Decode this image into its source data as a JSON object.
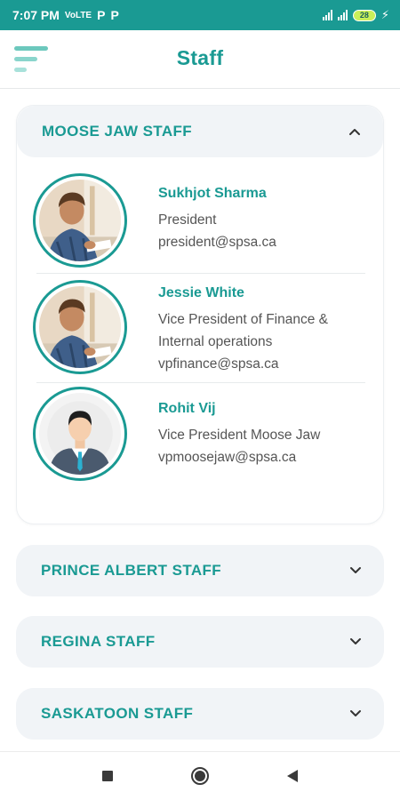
{
  "status_bar": {
    "time": "7:07 PM",
    "left_icons": [
      "volte-icon",
      "p-icon",
      "p-icon"
    ],
    "p_label": "P",
    "volte_label": "VoLTE",
    "battery": "28",
    "colors": {
      "bar": "#1a9a93",
      "battery": "#c9ef5a"
    }
  },
  "header": {
    "title": "Staff",
    "menu_icon": "menu-icon"
  },
  "sections": [
    {
      "title": "MOOSE JAW STAFF",
      "expanded": true,
      "chevron": "chevron-up-icon",
      "staff": [
        {
          "name": "Sukhjot Sharma",
          "role": "President",
          "email": "president@spsa.ca",
          "avatar": "photo"
        },
        {
          "name": "Jessie White",
          "role": "Vice President of Finance & Internal operations",
          "email": "vpfinance@spsa.ca",
          "avatar": "photo"
        },
        {
          "name": "Rohit Vij",
          "role": "Vice President Moose Jaw",
          "email": "vpmoosejaw@spsa.ca",
          "avatar": "placeholder"
        }
      ]
    },
    {
      "title": "PRINCE ALBERT STAFF",
      "expanded": false,
      "chevron": "chevron-down-icon"
    },
    {
      "title": "REGINA STAFF",
      "expanded": false,
      "chevron": "chevron-down-icon"
    },
    {
      "title": "SASKATOON STAFF",
      "expanded": false,
      "chevron": "chevron-down-icon"
    }
  ],
  "nav": [
    "recents-icon",
    "home-icon",
    "back-icon"
  ],
  "theme": {
    "accent": "#1a9a93",
    "card_header_bg": "#f1f4f7",
    "text": "#555555"
  }
}
